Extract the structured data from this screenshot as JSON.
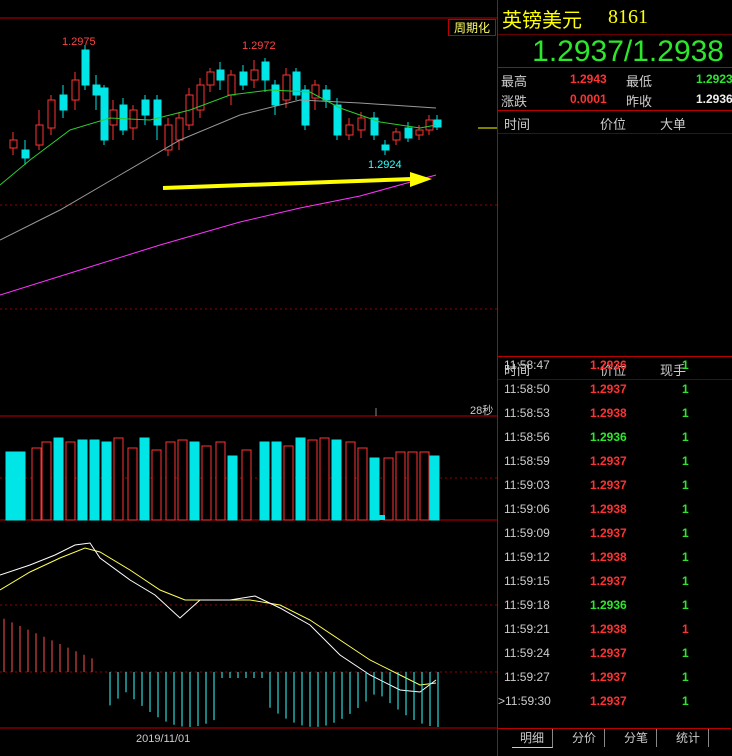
{
  "chart": {
    "period_button": "周期化",
    "seconds_label": "28秒",
    "date_label": "2019/11/01",
    "price_labels": [
      {
        "text": "1.2975",
        "color": "#ff4444"
      },
      {
        "text": "1.2972",
        "color": "#ff4444"
      },
      {
        "text": "1.2924",
        "color": "#33ffff"
      }
    ],
    "colors": {
      "up": "#ff3232",
      "down": "#00e5e5",
      "arrow": "#ffff00",
      "ma_long": "#ff33ff"
    }
  },
  "quote": {
    "name": "英镑美元",
    "code": "8161",
    "bid_ask": "1.2937/1.2938",
    "stats": {
      "high_label": "最高",
      "high_value": "1.2943",
      "low_label": "最低",
      "low_value": "1.2923",
      "change_label": "涨跌",
      "change_value": "0.0001",
      "prev_label": "昨收",
      "prev_value": "1.2936"
    },
    "big_orders_header": {
      "time": "时间",
      "price": "价位",
      "big": "大单"
    },
    "ticks_header": {
      "time": "时间",
      "price": "价位",
      "vol": "现手"
    },
    "ticks": [
      {
        "time": "11:58:47",
        "price": "1.2936",
        "price_color": "red",
        "vol": "1",
        "vol_color": "green"
      },
      {
        "time": "11:58:50",
        "price": "1.2937",
        "price_color": "red",
        "vol": "1",
        "vol_color": "green"
      },
      {
        "time": "11:58:53",
        "price": "1.2938",
        "price_color": "red",
        "vol": "1",
        "vol_color": "green"
      },
      {
        "time": "11:58:56",
        "price": "1.2936",
        "price_color": "green",
        "vol": "1",
        "vol_color": "green"
      },
      {
        "time": "11:58:59",
        "price": "1.2937",
        "price_color": "red",
        "vol": "1",
        "vol_color": "green"
      },
      {
        "time": "11:59:03",
        "price": "1.2937",
        "price_color": "red",
        "vol": "1",
        "vol_color": "green"
      },
      {
        "time": "11:59:06",
        "price": "1.2938",
        "price_color": "red",
        "vol": "1",
        "vol_color": "green"
      },
      {
        "time": "11:59:09",
        "price": "1.2937",
        "price_color": "red",
        "vol": "1",
        "vol_color": "green"
      },
      {
        "time": "11:59:12",
        "price": "1.2938",
        "price_color": "red",
        "vol": "1",
        "vol_color": "green"
      },
      {
        "time": "11:59:15",
        "price": "1.2937",
        "price_color": "red",
        "vol": "1",
        "vol_color": "green"
      },
      {
        "time": "11:59:18",
        "price": "1.2936",
        "price_color": "green",
        "vol": "1",
        "vol_color": "green"
      },
      {
        "time": "11:59:21",
        "price": "1.2938",
        "price_color": "red",
        "vol": "1",
        "vol_color": "red"
      },
      {
        "time": "11:59:24",
        "price": "1.2937",
        "price_color": "red",
        "vol": "1",
        "vol_color": "green"
      },
      {
        "time": "11:59:27",
        "price": "1.2937",
        "price_color": "red",
        "vol": "1",
        "vol_color": "green"
      },
      {
        "time": "11:59:30",
        "price": "1.2937",
        "price_color": "red",
        "vol": "1",
        "vol_color": "green",
        "marker": ">"
      }
    ],
    "tabs": [
      {
        "label": "明细",
        "active": true
      },
      {
        "label": "分价",
        "active": false
      },
      {
        "label": "分笔",
        "active": false
      },
      {
        "label": "统计",
        "active": false
      }
    ]
  }
}
